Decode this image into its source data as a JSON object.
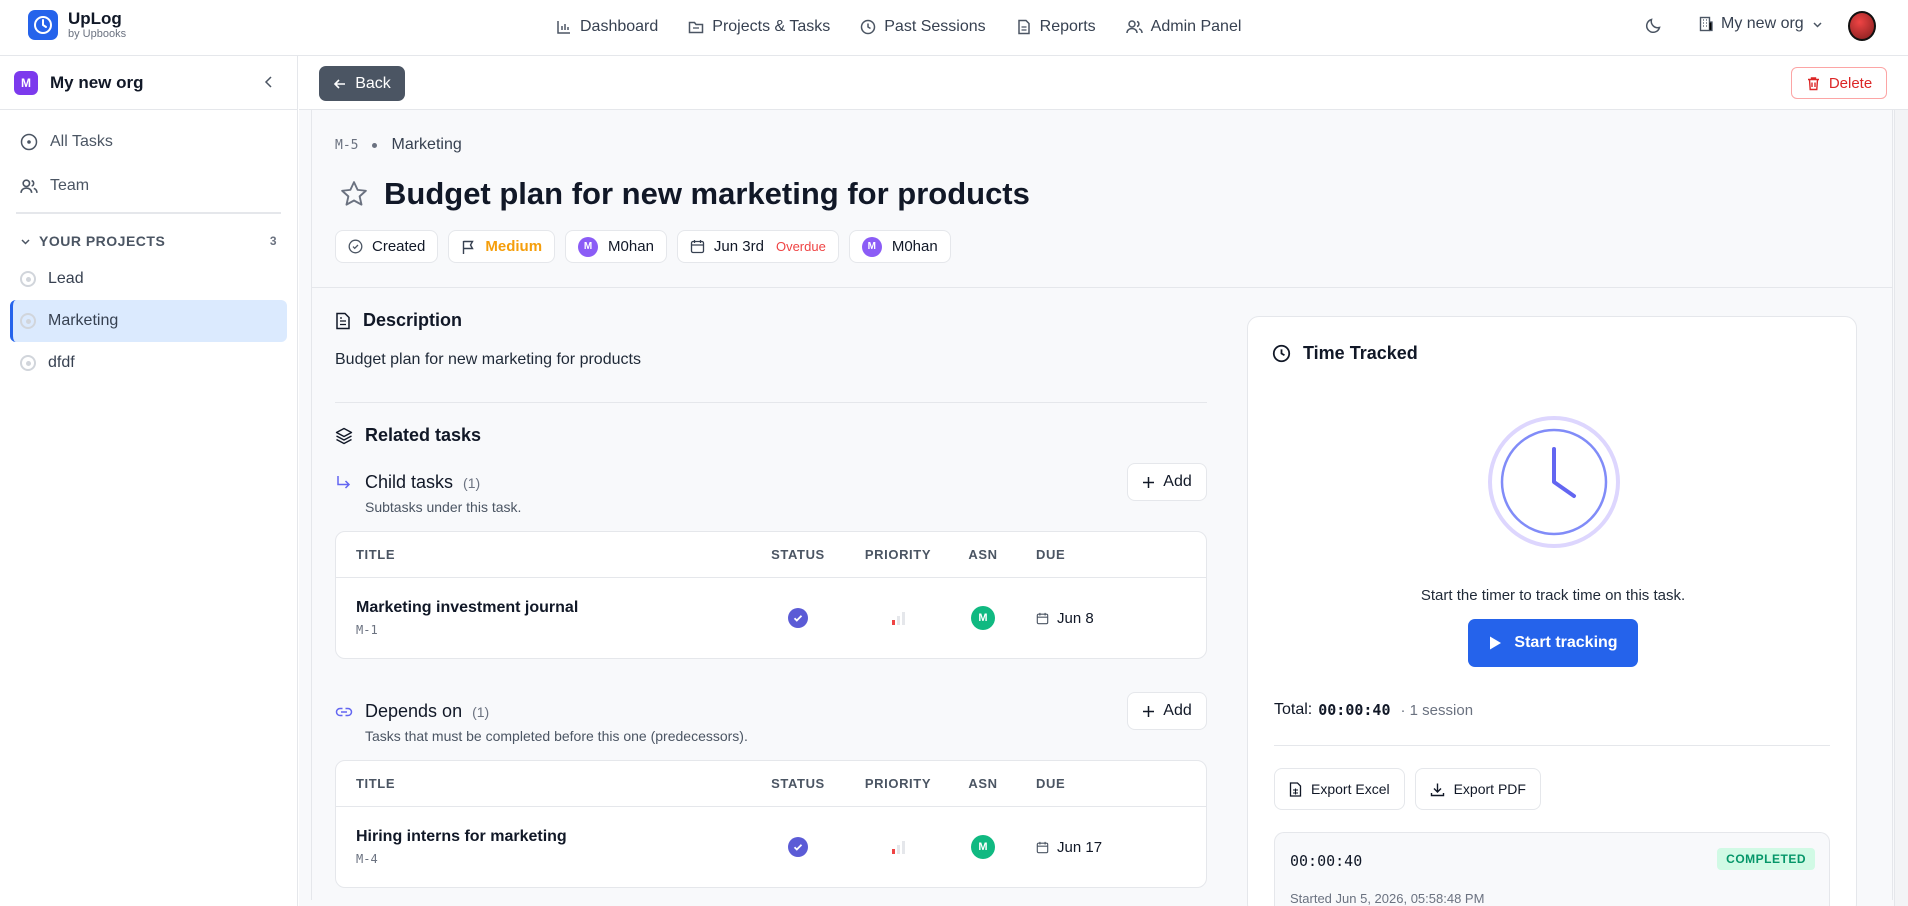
{
  "brand": {
    "name": "UpLog",
    "sub": "by Upbooks"
  },
  "nav": [
    {
      "label": "Dashboard",
      "icon": "bar-chart-icon"
    },
    {
      "label": "Projects & Tasks",
      "icon": "folder-icon"
    },
    {
      "label": "Past Sessions",
      "icon": "clock-icon"
    },
    {
      "label": "Reports",
      "icon": "document-icon"
    },
    {
      "label": "Admin Panel",
      "icon": "users-icon"
    }
  ],
  "org_switch": {
    "label": "My new org"
  },
  "sidebar": {
    "org_badge": "M",
    "org_name": "My new org",
    "items": [
      {
        "label": "All Tasks",
        "icon": "circle-dot-icon"
      },
      {
        "label": "Team",
        "icon": "users-icon"
      }
    ],
    "projects_header": "YOUR PROJECTS",
    "projects_count": "3",
    "projects": [
      {
        "label": "Lead",
        "active": false
      },
      {
        "label": "Marketing",
        "active": true
      },
      {
        "label": "dfdf",
        "active": false
      }
    ]
  },
  "toolbar": {
    "back_label": "Back",
    "delete_label": "Delete"
  },
  "task": {
    "key": "M-5",
    "project": "Marketing",
    "title": "Budget plan for new marketing for products",
    "chips": {
      "status": "Created",
      "priority": "Medium",
      "assignee_initial": "M",
      "assignee": "M0han",
      "due": "Jun 3rd",
      "overdue": "Overdue",
      "reporter_initial": "M",
      "reporter": "M0han"
    },
    "description_title": "Description",
    "description": "Budget plan for new marketing for products",
    "related_title": "Related tasks"
  },
  "child_tasks": {
    "title": "Child tasks",
    "count": "(1)",
    "desc": "Subtasks under this task.",
    "add_label": "Add",
    "columns": [
      "TITLE",
      "STATUS",
      "PRIORITY",
      "ASN",
      "DUE"
    ],
    "rows": [
      {
        "title": "Marketing investment journal",
        "key": "M-1",
        "asn": "M",
        "due": "Jun 8",
        "priority_level": 1
      }
    ]
  },
  "depends_on": {
    "title": "Depends on",
    "count": "(1)",
    "desc": "Tasks that must be completed before this one (predecessors).",
    "add_label": "Add",
    "columns": [
      "TITLE",
      "STATUS",
      "PRIORITY",
      "ASN",
      "DUE"
    ],
    "rows": [
      {
        "title": "Hiring interns for marketing",
        "key": "M-4",
        "asn": "M",
        "due": "Jun 17",
        "priority_level": 1
      }
    ]
  },
  "time_tracked": {
    "title": "Time Tracked",
    "hint": "Start the timer to track time on this task.",
    "start_label": "Start tracking",
    "total_label": "Total:",
    "total_value": "00:00:40",
    "sessions": "· 1 session",
    "export_excel": "Export Excel",
    "export_pdf": "Export PDF",
    "session": {
      "duration": "00:00:40",
      "status": "COMPLETED",
      "started": "Started Jun 5, 2026, 05:58:48 PM"
    }
  },
  "colors": {
    "accent": "#2563eb",
    "danger": "#dc2626",
    "priority_medium": "#f59e0b",
    "success": "#059669",
    "status_done": "#5b5bd6"
  }
}
